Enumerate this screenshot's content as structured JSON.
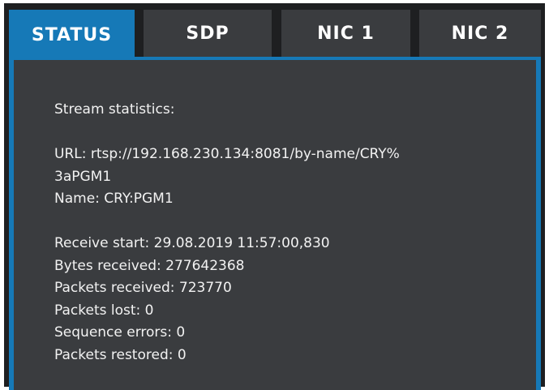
{
  "tabs": [
    {
      "label": "STATUS",
      "active": true
    },
    {
      "label": "SDP",
      "active": false
    },
    {
      "label": "NIC 1",
      "active": false
    },
    {
      "label": "NIC 2",
      "active": false
    }
  ],
  "colors": {
    "accent": "#1679b7",
    "panel_bg": "#3a3c3f",
    "frame_bg": "#1e1f21",
    "text": "#f2f2f2"
  },
  "status": {
    "heading": "Stream statistics:",
    "url_line1": "URL: rtsp://192.168.230.134:8081/by-name/CRY%",
    "url_line2": "3aPGM1",
    "name": "Name: CRY:PGM1",
    "receive_start": "Receive start: 29.08.2019 11:57:00,830",
    "bytes_received": "Bytes received: 277642368",
    "packets_received": "Packets received: 723770",
    "packets_lost": "Packets lost: 0",
    "sequence_errors": "Sequence errors: 0",
    "packets_restored": "Packets restored: 0"
  }
}
